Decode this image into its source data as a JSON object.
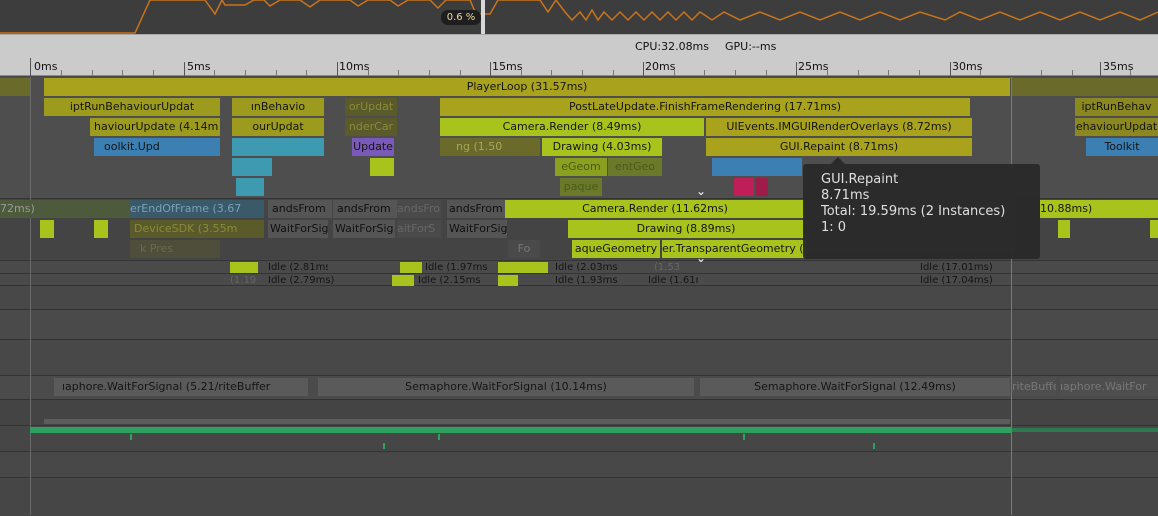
{
  "graph": {
    "percent_badge": "0.6 %",
    "line_color": "#c9741b"
  },
  "header": {
    "cpu_label": "CPU:32.08ms",
    "gpu_label": "GPU:--ms"
  },
  "ruler": {
    "labels": [
      "0ms",
      "5ms",
      "10ms",
      "15ms",
      "20ms",
      "25ms",
      "30ms",
      "35ms"
    ]
  },
  "main_thread": {
    "player_loop": "PlayerLoop (31.57ms)",
    "depth1": [
      "iptRunBehaviourUpdat",
      "ınBehavio",
      "orUpdat",
      "PostLateUpdate.FinishFrameRendering (17.71ms)",
      "iptRunBehav"
    ],
    "depth2": [
      "haviourUpdate (4.14m",
      "ourUpdat",
      "nderCar",
      "Camera.Render (8.49ms)",
      "UIEvents.IMGUIRenderOverlays (8.72ms)",
      "ehaviourUpdat"
    ],
    "depth3": [
      "oolkit.Upd",
      "Update",
      "ng (1.50",
      "Drawing (4.03ms)",
      "GUI.Repaint (8.71ms)",
      "Toolkit"
    ],
    "depth4": [
      "eGeom",
      "entGeo"
    ],
    "depth5": [
      "paque"
    ]
  },
  "render_thread": {
    "row1": [
      "72ms)",
      "erEndOfFrame (3.67",
      "andsFrom",
      "andsFrom",
      "andsFro",
      "andsFrom",
      "Camera.Render (11.62ms)",
      "10.88ms)"
    ],
    "row2": [
      "DeviceSDK (3.55m",
      "WaitForSig",
      "WaitForSig",
      "aitForS",
      "WaitForSig",
      "Drawing (8.89ms)"
    ],
    "row3": [
      "k Pres",
      "Fo",
      "aqueGeometry",
      "er.TransparentGeometry (3.6"
    ]
  },
  "workers": {
    "row1": [
      "Idle (2.81ms)",
      "Idle (1.97ms",
      "Idle (2.03ms",
      "(1.53",
      "Idle (17.01ms)"
    ],
    "row2": [
      "(1.19",
      "Idle (2.79ms)",
      "Idle (2.15ms",
      "Idle (1.93ms",
      "Idle (1.61m",
      "Idle (17.04ms)"
    ]
  },
  "semaphore_row": [
    "ıaphore.WaitForSignal (5.21/riteBuffer",
    "Semaphore.WaitForSignal (10.14ms)",
    "Semaphore.WaitForSignal (12.49ms)",
    "riteBuffe",
    "ıaphore.WaitFor"
  ],
  "tooltip": {
    "name": "GUI.Repaint",
    "time": "8.71ms",
    "total": "Total: 19.59ms (2 Instances)",
    "instance": "1: 0"
  },
  "colors": {
    "marker_green": "#a8c41c",
    "marker_teal": "#3d9ab0",
    "marker_blue": "#3c7fb2",
    "marker_purple": "#7a5ab8",
    "marker_pink": "#c01e58",
    "gpu_line": "#2ea060"
  }
}
